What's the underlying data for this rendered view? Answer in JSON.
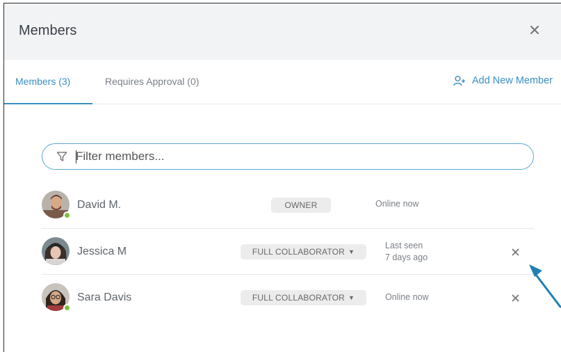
{
  "dialog": {
    "title": "Members",
    "close_icon": "close-icon"
  },
  "tabs": [
    {
      "label": "Members (3)",
      "active": true
    },
    {
      "label": "Requires Approval (0)",
      "active": false
    }
  ],
  "add_member": {
    "label": "Add New Member",
    "icon": "add-user-icon"
  },
  "filter": {
    "placeholder": "Filter members...",
    "icon": "filter-icon"
  },
  "members": [
    {
      "name": "David M.",
      "role": "OWNER",
      "presence_line1": "Online now",
      "presence_line2": "",
      "online": true,
      "removable": false
    },
    {
      "name": "Jessica M",
      "role": "FULL COLLABORATOR",
      "presence_line1": "Last seen",
      "presence_line2": "7 days ago",
      "online": false,
      "removable": true
    },
    {
      "name": "Sara Davis",
      "role": "FULL COLLABORATOR",
      "presence_line1": "Online now",
      "presence_line2": "",
      "online": true,
      "removable": true
    }
  ],
  "colors": {
    "accent": "#3a8fc2",
    "online": "#7ac143",
    "annotation_arrow": "#1f7fb4"
  }
}
